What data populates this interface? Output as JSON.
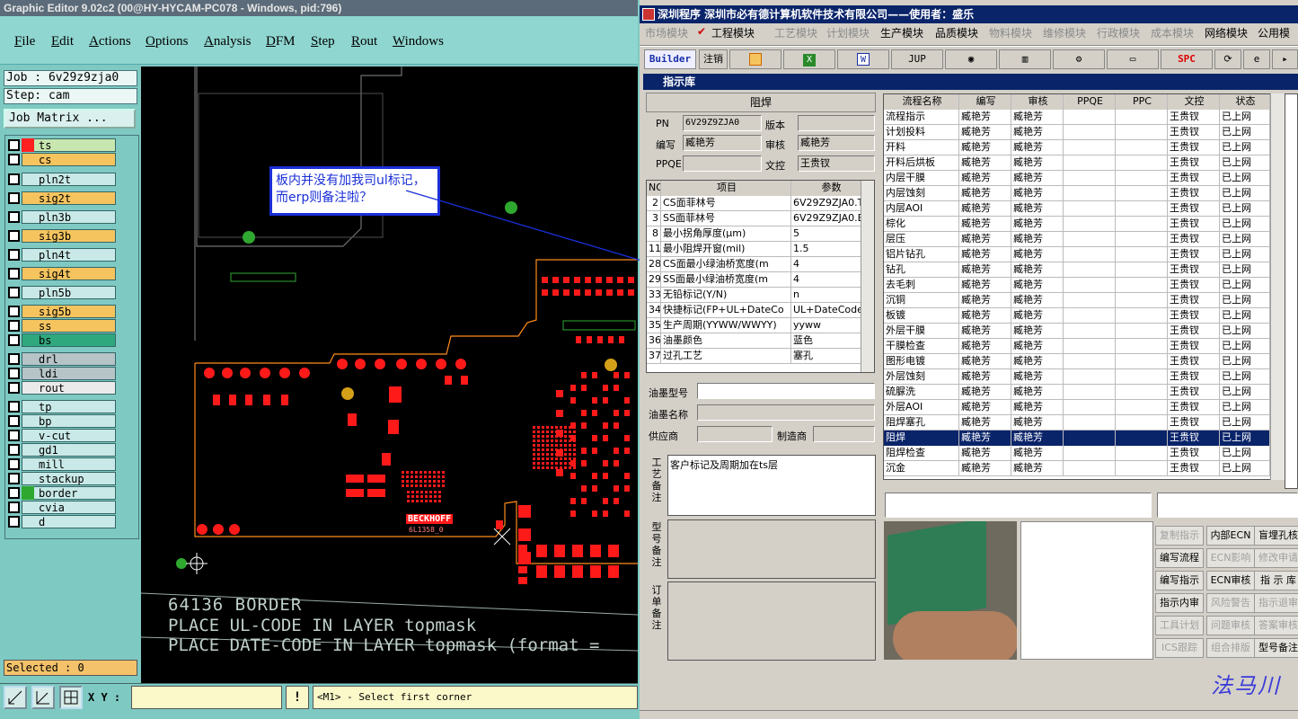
{
  "cam": {
    "title": "Graphic Editor 9.02c2 (00@HY-HYCAM-PC078 - Windows, pid:796)",
    "menu": [
      "File",
      "Edit",
      "Actions",
      "Options",
      "Analysis",
      "DFM",
      "Step",
      "Rout",
      "Windows"
    ],
    "job": "Job : 6v29z9zja0",
    "step": "Step: cam",
    "job_matrix": "Job Matrix ...",
    "layers": [
      {
        "name": "ts",
        "color": "#c8e7b0",
        "swatch": "#ff2020"
      },
      {
        "name": "cs",
        "color": "#f6c45f"
      },
      {
        "name": "pln2t",
        "color": "#c8e9e7"
      },
      {
        "name": "sig2t",
        "color": "#f6c45f"
      },
      {
        "name": "pln3b",
        "color": "#c8e9e7"
      },
      {
        "name": "sig3b",
        "color": "#f6c45f"
      },
      {
        "name": "pln4t",
        "color": "#c8e9e7"
      },
      {
        "name": "sig4t",
        "color": "#f6c45f"
      },
      {
        "name": "pln5b",
        "color": "#c8e9e7"
      },
      {
        "name": "sig5b",
        "color": "#f6c45f"
      },
      {
        "name": "ss",
        "color": "#f6c45f"
      },
      {
        "name": "bs",
        "color": "#2fa87e"
      },
      {
        "name": "drl",
        "color": "#b6c4c8"
      },
      {
        "name": "ldi",
        "color": "#b6c4c8"
      },
      {
        "name": "rout",
        "color": "#eaeaea"
      },
      {
        "name": "tp",
        "color": "#c8e9e7"
      },
      {
        "name": "bp",
        "color": "#c8e9e7"
      },
      {
        "name": "v-cut",
        "color": "#c8e9e7"
      },
      {
        "name": "gd1",
        "color": "#c8e9e7"
      },
      {
        "name": "mill",
        "color": "#c8e9e7"
      },
      {
        "name": "stackup",
        "color": "#c8e9e7"
      },
      {
        "name": "border",
        "color": "#c8e9e7",
        "swatch": "#2fa82f"
      },
      {
        "name": "cvia",
        "color": "#c8e9e7"
      },
      {
        "name": "d",
        "color": "#c8e9e7"
      }
    ],
    "selected": "Selected : 0",
    "xy_label": "X Y :",
    "prompt_button": "!",
    "prompt": "<M1> - Select first corner",
    "annotation": "板内并没有加我司ul标记，而erp则备注啦？",
    "canvas_text": [
      "64136  BORDER",
      "PLACE UL-CODE IN LAYER topmask",
      "PLACE DATE-CODE IN LAYER topmask (format ="
    ],
    "silk": [
      "BECKHOFF",
      "6L1358_0"
    ]
  },
  "erp": {
    "title": "深圳程序    深圳市必有德计算机软件技术有限公司——使用者：盛乐",
    "modules": [
      {
        "label": "市场模块",
        "on": false
      },
      {
        "label": "工程模块",
        "on": true
      },
      {
        "label": "工艺模块",
        "on": false
      },
      {
        "label": "计划模块",
        "on": false
      },
      {
        "label": "生产模块",
        "on": true
      },
      {
        "label": "品质模块",
        "on": true
      },
      {
        "label": "物料模块",
        "on": false
      },
      {
        "label": "维修模块",
        "on": false
      },
      {
        "label": "行政模块",
        "on": false
      },
      {
        "label": "成本模块",
        "on": false
      },
      {
        "label": "网络模块",
        "on": true
      },
      {
        "label": "公用模",
        "on": true
      }
    ],
    "toolbar": {
      "builder": "Builder",
      "logout": "注销",
      "jup": "JUP",
      "spc": "SPC"
    },
    "panel_title": "指示库",
    "form_heading": "阻焊",
    "labels": {
      "pn": "PN",
      "version": "版本",
      "editor": "编写",
      "reviewer": "审核",
      "ppqe": "PPQE",
      "doc": "文控",
      "ink_model": "油墨型号",
      "ink_name": "油墨名称",
      "supplier": "供应商",
      "maker": "制造商",
      "craft_note": "工艺备注",
      "model_note": "型号备注",
      "order_note": "订单备注"
    },
    "values": {
      "pn": "6V29Z9ZJA0",
      "version": "",
      "editor": "臧艳芳",
      "reviewer": "臧艳芳",
      "ppqe": "",
      "doc": "王贵钗",
      "craft_note": "客户标记及周期加在ts层"
    },
    "param_headers": [
      "NO",
      "项目",
      "参数"
    ],
    "params": [
      [
        "2",
        "CS面菲林号",
        "6V29Z9ZJA0.TS"
      ],
      [
        "3",
        "SS面菲林号",
        "6V29Z9ZJA0.BS"
      ],
      [
        "8",
        "最小拐角厚度(μm)",
        "5"
      ],
      [
        "11",
        "最小阻焊开窗(mil)",
        "1.5"
      ],
      [
        "28",
        "CS面最小绿油桥宽度(m",
        "4"
      ],
      [
        "29",
        "SS面最小绿油桥宽度(m",
        "4"
      ],
      [
        "33",
        "无铅标记(Y/N)",
        "n"
      ],
      [
        "34",
        "快捷标记(FP+UL+DateCo",
        "UL+DateCode)"
      ],
      [
        "35",
        "生产周期(YYWW/WWYY)",
        "yyww"
      ],
      [
        "36",
        "油墨颜色",
        "蓝色"
      ],
      [
        "37",
        "过孔工艺",
        "塞孔"
      ]
    ],
    "flow_headers": [
      "流程名称",
      "编写",
      "审核",
      "PPQE",
      "PPC",
      "文控",
      "状态"
    ],
    "flows": [
      [
        "流程指示",
        "臧艳芳",
        "臧艳芳",
        "",
        "",
        "王贵钗",
        "已上网"
      ],
      [
        "计划投料",
        "臧艳芳",
        "臧艳芳",
        "",
        "",
        "王贵钗",
        "已上网"
      ],
      [
        "开料",
        "臧艳芳",
        "臧艳芳",
        "",
        "",
        "王贵钗",
        "已上网"
      ],
      [
        "开料后烘板",
        "臧艳芳",
        "臧艳芳",
        "",
        "",
        "王贵钗",
        "已上网"
      ],
      [
        "内层干膜",
        "臧艳芳",
        "臧艳芳",
        "",
        "",
        "王贵钗",
        "已上网"
      ],
      [
        "内层蚀刻",
        "臧艳芳",
        "臧艳芳",
        "",
        "",
        "王贵钗",
        "已上网"
      ],
      [
        "内层AOI",
        "臧艳芳",
        "臧艳芳",
        "",
        "",
        "王贵钗",
        "已上网"
      ],
      [
        "棕化",
        "臧艳芳",
        "臧艳芳",
        "",
        "",
        "王贵钗",
        "已上网"
      ],
      [
        "层压",
        "臧艳芳",
        "臧艳芳",
        "",
        "",
        "王贵钗",
        "已上网"
      ],
      [
        "铝片钻孔",
        "臧艳芳",
        "臧艳芳",
        "",
        "",
        "王贵钗",
        "已上网"
      ],
      [
        "钻孔",
        "臧艳芳",
        "臧艳芳",
        "",
        "",
        "王贵钗",
        "已上网"
      ],
      [
        "去毛刺",
        "臧艳芳",
        "臧艳芳",
        "",
        "",
        "王贵钗",
        "已上网"
      ],
      [
        "沉铜",
        "臧艳芳",
        "臧艳芳",
        "",
        "",
        "王贵钗",
        "已上网"
      ],
      [
        "板镀",
        "臧艳芳",
        "臧艳芳",
        "",
        "",
        "王贵钗",
        "已上网"
      ],
      [
        "外层干膜",
        "臧艳芳",
        "臧艳芳",
        "",
        "",
        "王贵钗",
        "已上网"
      ],
      [
        "干膜检查",
        "臧艳芳",
        "臧艳芳",
        "",
        "",
        "王贵钗",
        "已上网"
      ],
      [
        "图形电镀",
        "臧艳芳",
        "臧艳芳",
        "",
        "",
        "王贵钗",
        "已上网"
      ],
      [
        "外层蚀刻",
        "臧艳芳",
        "臧艳芳",
        "",
        "",
        "王贵钗",
        "已上网"
      ],
      [
        "硫脲洗",
        "臧艳芳",
        "臧艳芳",
        "",
        "",
        "王贵钗",
        "已上网"
      ],
      [
        "外层AOI",
        "臧艳芳",
        "臧艳芳",
        "",
        "",
        "王贵钗",
        "已上网"
      ],
      [
        "阻焊塞孔",
        "臧艳芳",
        "臧艳芳",
        "",
        "",
        "王贵钗",
        "已上网"
      ],
      [
        "阻焊",
        "臧艳芳",
        "臧艳芳",
        "",
        "",
        "王贵钗",
        "已上网"
      ],
      [
        "阻焊检查",
        "臧艳芳",
        "臧艳芳",
        "",
        "",
        "王贵钗",
        "已上网"
      ],
      [
        "沉金",
        "臧艳芳",
        "臧艳芳",
        "",
        "",
        "王贵钗",
        "已上网"
      ]
    ],
    "buttons": [
      [
        {
          "label": "复制指示",
          "on": false
        },
        {
          "label": "内部ECN",
          "on": true
        },
        {
          "label": "盲埋孔核",
          "on": true
        }
      ],
      [
        {
          "label": "编写流程",
          "on": true
        },
        {
          "label": "ECN影响",
          "on": false
        },
        {
          "label": "修改申请",
          "on": false
        }
      ],
      [
        {
          "label": "编写指示",
          "on": true
        },
        {
          "label": "ECN审核",
          "on": true
        },
        {
          "label": "指 示 库",
          "on": true
        }
      ],
      [
        {
          "label": "指示内审",
          "on": true
        },
        {
          "label": "风险警告",
          "on": false
        },
        {
          "label": "指示退审",
          "on": false
        }
      ],
      [
        {
          "label": "工具计划",
          "on": false
        },
        {
          "label": "问题审核",
          "on": false
        },
        {
          "label": "答案审核",
          "on": false
        }
      ],
      [
        {
          "label": "ICS跟踪",
          "on": false
        },
        {
          "label": "组合排版",
          "on": false
        },
        {
          "label": "型号备注",
          "on": true
        }
      ]
    ],
    "watermark": "法马川"
  }
}
